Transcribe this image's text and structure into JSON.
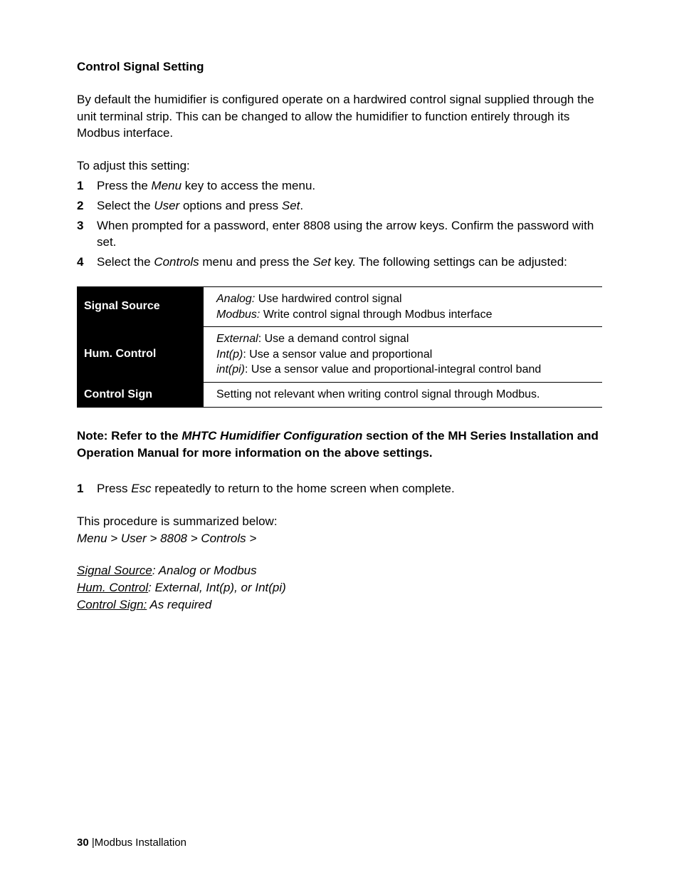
{
  "heading": "Control Signal Setting",
  "intro": "By default the humidifier is configured operate on a hardwired control signal supplied through the unit terminal strip.  This can be changed to allow the humidifier to function entirely through its Modbus interface.",
  "adjust_leadin": "To adjust this setting:",
  "steps": {
    "s1": {
      "num": "1",
      "pre": "Press the ",
      "menu": "Menu",
      "post": " key to access the menu."
    },
    "s2": {
      "num": "2",
      "pre": "Select the ",
      "user": "User",
      "mid": " options and press ",
      "set": "Set",
      "post": "."
    },
    "s3": {
      "num": "3",
      "text": "When prompted for a password, enter 8808 using the arrow keys.  Confirm the password with set."
    },
    "s4": {
      "num": "4",
      "pre": "Select the ",
      "controls": "Controls",
      "mid": " menu and press the ",
      "set": "Set",
      "post": " key.  The following settings can be adjusted:"
    }
  },
  "table": {
    "r1": {
      "label": "Signal Source",
      "l1a": "Analog:",
      "l1b": "  Use hardwired control signal",
      "l2a": "Modbus:",
      "l2b": " Write control signal through Modbus interface"
    },
    "r2": {
      "label": "Hum. Control",
      "l1a": "External",
      "l1b": ": Use a demand control signal",
      "l2a": "Int(p)",
      "l2b": ": Use a sensor value and proportional",
      "l3a": "int(pi)",
      "l3b": ": Use a sensor value and proportional-integral control band"
    },
    "r3": {
      "label": "Control Sign",
      "text": "Setting not relevant when writing control signal through Modbus."
    }
  },
  "note": {
    "pre": "Note: Refer to the ",
    "config": "MHTC Humidifier Configuration",
    "post": " section of the MH Series Installation and Operation Manual for more information on the above settings."
  },
  "final_step": {
    "num": "1",
    "pre": "Press ",
    "esc": "Esc",
    "post": " repeatedly to return to the home screen when complete."
  },
  "summary": {
    "line1": "This procedure is summarized below:",
    "path": "Menu > User > 8808 > Controls >",
    "sig_label": "Signal Source",
    "sig_val": ": Analog or Modbus",
    "hum_label": "Hum. Control",
    "hum_val": ": External, Int(p), or Int(pi)",
    "cs_label": "Control Sign:",
    "cs_val": " As required"
  },
  "footer": {
    "page": "30",
    "sep": "  |",
    "title": "Modbus Installation"
  }
}
